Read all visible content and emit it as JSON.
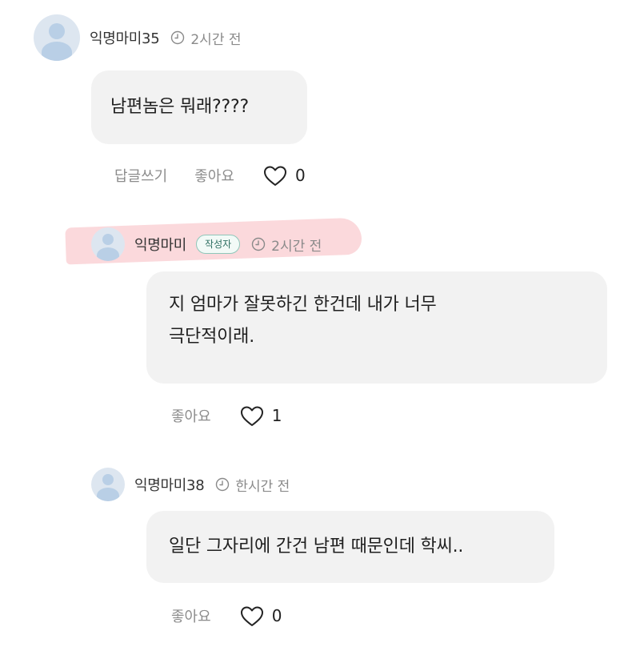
{
  "comments": [
    {
      "username": "익명마미35",
      "time": "2시간 전",
      "text": "남편놈은 뭐래????",
      "reply_label": "답글쓰기",
      "like_label": "좋아요",
      "like_count": "0"
    },
    {
      "username": "익명마미",
      "badge": "작성자",
      "time": "2시간 전",
      "text_line1": "지 엄마가 잘못하긴 한건데 내가 너무",
      "text_line2": "극단적이래.",
      "like_label": "좋아요",
      "like_count": "1"
    },
    {
      "username": "익명마미38",
      "time": "한시간 전",
      "text": "일단 그자리에 간건 남편 때문인데 학씨..",
      "like_label": "좋아요",
      "like_count": "0"
    }
  ],
  "icons": {
    "avatar": "avatar-placeholder-icon",
    "time": "clock-icon",
    "like": "heart-outline-icon"
  },
  "colors": {
    "bubble": "#f2f2f2",
    "badge_border": "#8fc7ba",
    "highlight": "#f6aab2",
    "avatar": "#b9cfe6"
  }
}
